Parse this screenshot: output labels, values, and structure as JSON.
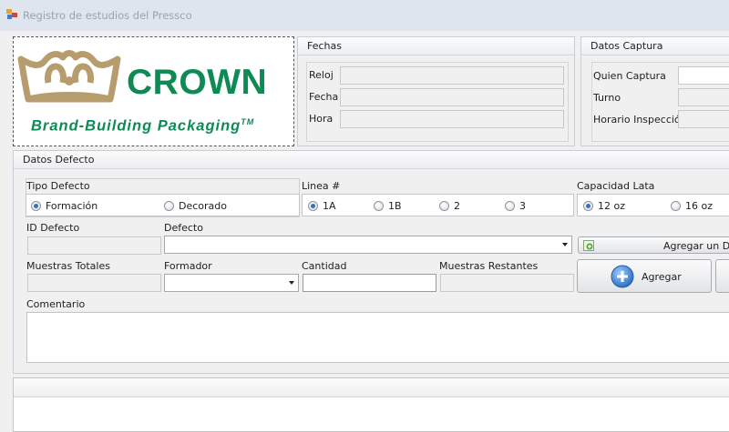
{
  "window": {
    "title": "Registro de estudios del Pressco"
  },
  "logo": {
    "brand": "CROWN",
    "tagline": "Brand-Building Packaging",
    "tm": "TM"
  },
  "fechas": {
    "title": "Fechas",
    "reloj_label": "Reloj",
    "reloj_value": "",
    "fecha_label": "Fecha",
    "fecha_value": "",
    "hora_label": "Hora",
    "hora_value": ""
  },
  "captura": {
    "title": "Datos Captura",
    "quien_label": "Quien Captura",
    "quien_value": "",
    "turno_label": "Turno",
    "turno_value": "",
    "horario_label": "Horario Inspección",
    "horario_value": ""
  },
  "defecto": {
    "title": "Datos Defecto",
    "tipo_label": "Tipo Defecto",
    "tipo_options": [
      {
        "label": "Formación",
        "checked": true
      },
      {
        "label": "Decorado",
        "checked": false
      }
    ],
    "linea_label": "Linea #",
    "linea_options": [
      {
        "label": "1A",
        "checked": true
      },
      {
        "label": "1B",
        "checked": false
      },
      {
        "label": "2",
        "checked": false
      },
      {
        "label": "3",
        "checked": false
      }
    ],
    "capacidad_label": "Capacidad Lata",
    "capacidad_options": [
      {
        "label": "12 oz",
        "checked": true
      },
      {
        "label": "16 oz",
        "checked": false
      }
    ],
    "id_label": "ID Defecto",
    "id_value": "",
    "defecto_label": "Defecto",
    "defecto_value": "",
    "agregar_defecto_label": "Agregar un Defecto",
    "muestras_totales_label": "Muestras Totales",
    "muestras_totales_value": "",
    "formador_label": "Formador",
    "formador_value": "",
    "cantidad_label": "Cantidad",
    "cantidad_value": "",
    "muestras_restantes_label": "Muestras Restantes",
    "muestras_restantes_value": "",
    "agregar_label": "Agregar",
    "comentario_label": "Comentario",
    "comentario_value": ""
  }
}
